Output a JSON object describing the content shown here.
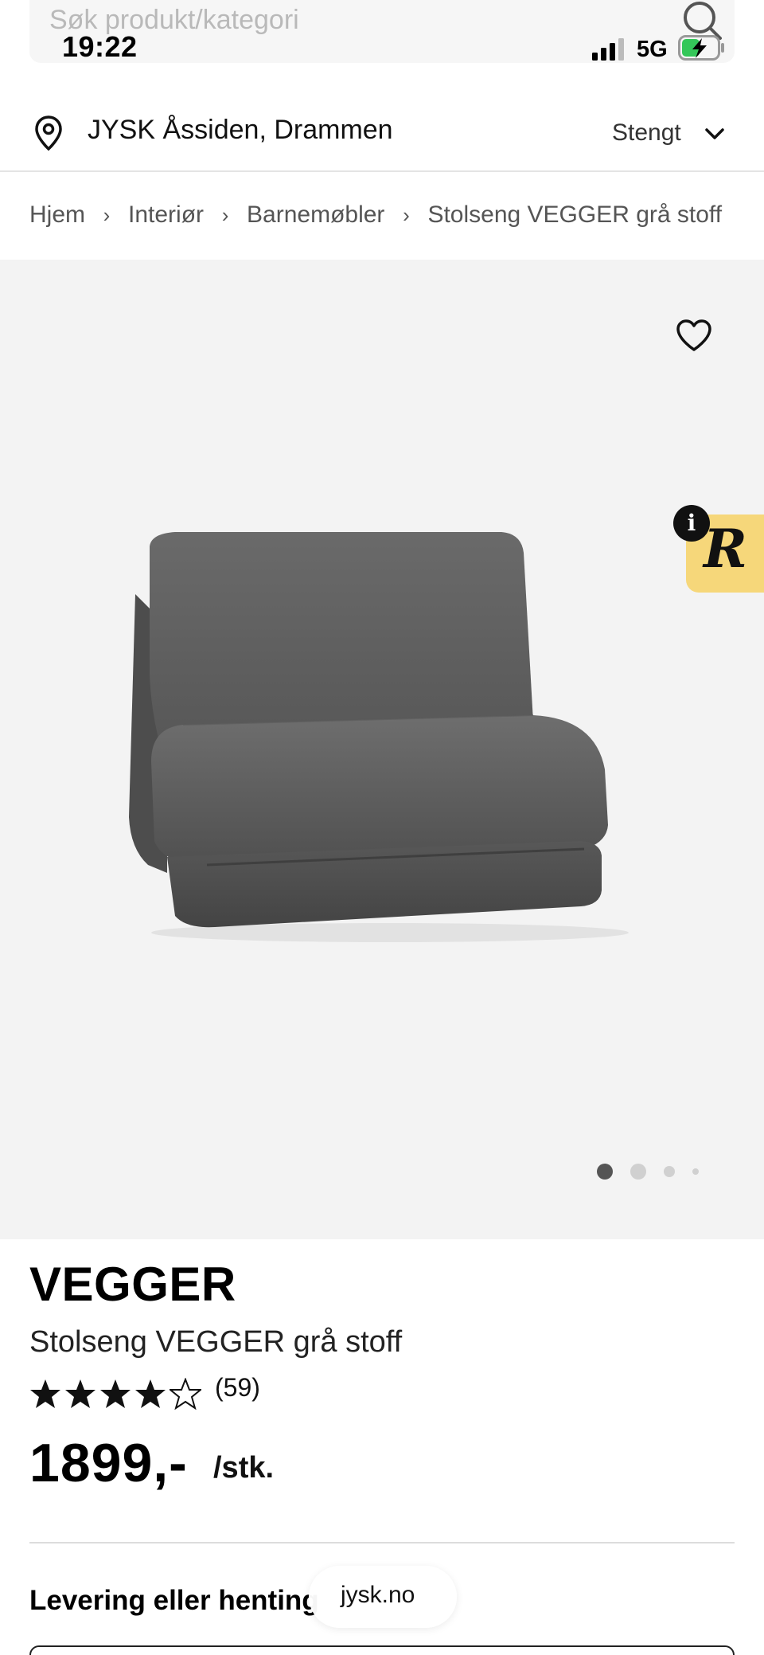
{
  "search": {
    "placeholder": "Søk produkt/kategori"
  },
  "status_bar": {
    "time": "19:22",
    "network": "5G"
  },
  "store": {
    "name": "JYSK Åssiden, Drammen",
    "status": "Stengt"
  },
  "breadcrumb": {
    "items": [
      "Hjem",
      "Interiør",
      "Barnemøbler",
      "Stolseng VEGGER grå stoff"
    ],
    "separator": "›"
  },
  "gallery": {
    "image_count": 4,
    "active_index": 0
  },
  "badge": {
    "letter": "R",
    "info": "i"
  },
  "product": {
    "brand": "VEGGER",
    "title": "Stolseng VEGGER grå stoff",
    "rating": 4.5,
    "review_count": "(59)",
    "price": "1899,-",
    "unit": "/stk."
  },
  "delivery": {
    "heading": "Levering eller henting"
  },
  "browser": {
    "url": "jysk.no"
  },
  "colors": {
    "gallery_bg": "#f3f3f3",
    "badge_yellow": "#f6d77a",
    "text": "#111111"
  }
}
